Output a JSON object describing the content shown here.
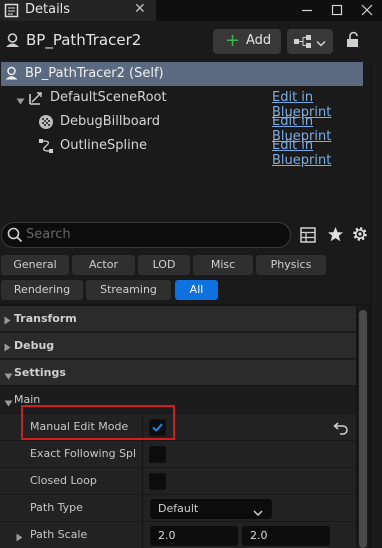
{
  "tab": {
    "title": "Details",
    "icon": "details-icon",
    "close": "✕"
  },
  "window": {
    "minimize": "—",
    "maximize": "☐",
    "close": "✕"
  },
  "header": {
    "blueprint_name": "BP_PathTracer2",
    "add_label": "Add",
    "icons": [
      "actor-icon",
      "blueprint-hierarchy-icon",
      "lock-icon"
    ]
  },
  "tree": {
    "self": "BP_PathTracer2 (Self)",
    "items": [
      {
        "label": "DefaultSceneRoot",
        "icon": "scene-root-icon",
        "edit": "Edit in Blueprint"
      },
      {
        "label": "DebugBillboard",
        "icon": "billboard-icon",
        "edit": "Edit in Blueprint"
      },
      {
        "label": "OutlineSpline",
        "icon": "spline-icon",
        "edit": "Edit in Blueprint"
      }
    ]
  },
  "search": {
    "placeholder": "Search"
  },
  "categories": {
    "row1": [
      "General",
      "Actor",
      "LOD",
      "Misc",
      "Physics"
    ],
    "row2": [
      "Rendering",
      "Streaming",
      "All"
    ],
    "active": "All"
  },
  "sections": {
    "transform": "Transform",
    "debug": "Debug",
    "settings": "Settings",
    "main": "Main"
  },
  "properties": {
    "manual_edit_mode": {
      "label": "Manual Edit Mode",
      "checked": true
    },
    "exact_following": {
      "label": "Exact Following Spl...",
      "checked": false
    },
    "closed_loop": {
      "label": "Closed Loop",
      "checked": false
    },
    "path_type": {
      "label": "Path Type",
      "value": "Default"
    },
    "path_scale": {
      "label": "Path Scale",
      "x": "2.0",
      "y": "2.0"
    }
  },
  "colors": {
    "accent": "#0f70e0",
    "highlight": "#d41c1c",
    "link": "#7aaee8",
    "add_plus": "#3cb449"
  }
}
